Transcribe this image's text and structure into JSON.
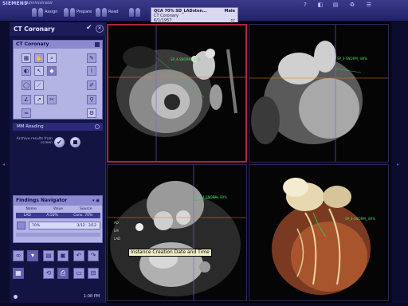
{
  "app": {
    "brand": "SIEMENS",
    "role": "Administrator"
  },
  "workflow": {
    "steps": [
      {
        "label": "Assign"
      },
      {
        "label": "Prepare"
      },
      {
        "label": "Read"
      }
    ]
  },
  "patient": {
    "line1": "QCA 70% SD_LADsten...",
    "sex": "Male",
    "line2": "CT Coronary",
    "dob": "6/1/1957",
    "code": "cc"
  },
  "top_icons": [
    "?",
    "◧",
    "▤",
    "♻",
    "☰"
  ],
  "left_panel": {
    "title": "CT Coronary",
    "tool_card_title": "CT Coronary",
    "mm_reading": "MM Reading",
    "archive_label": "Archive results from screen",
    "findings": {
      "title": "Findings Navigator",
      "columns": [
        "Name",
        "Value",
        "Source"
      ],
      "row": [
        "LAD",
        "A:50%",
        "Cons. 70%"
      ],
      "detail_left": "70%",
      "detail_right": "3/12 · 3/12"
    },
    "clock": "1:08 PM"
  },
  "viewer": {
    "tooltip": "Instance Creation Date and Time",
    "labels": {
      "tl": "SP_4-SNORM_ 80%",
      "tr": "SP_4-SNORM_ 80%",
      "bl": "SP_4-SNORM_ 80%",
      "br": "SP_4-SNORM_ 80%"
    }
  },
  "colors": {
    "accent": "#b0243a",
    "green_annot": "#40e060",
    "panel": "#b4b4e4"
  }
}
